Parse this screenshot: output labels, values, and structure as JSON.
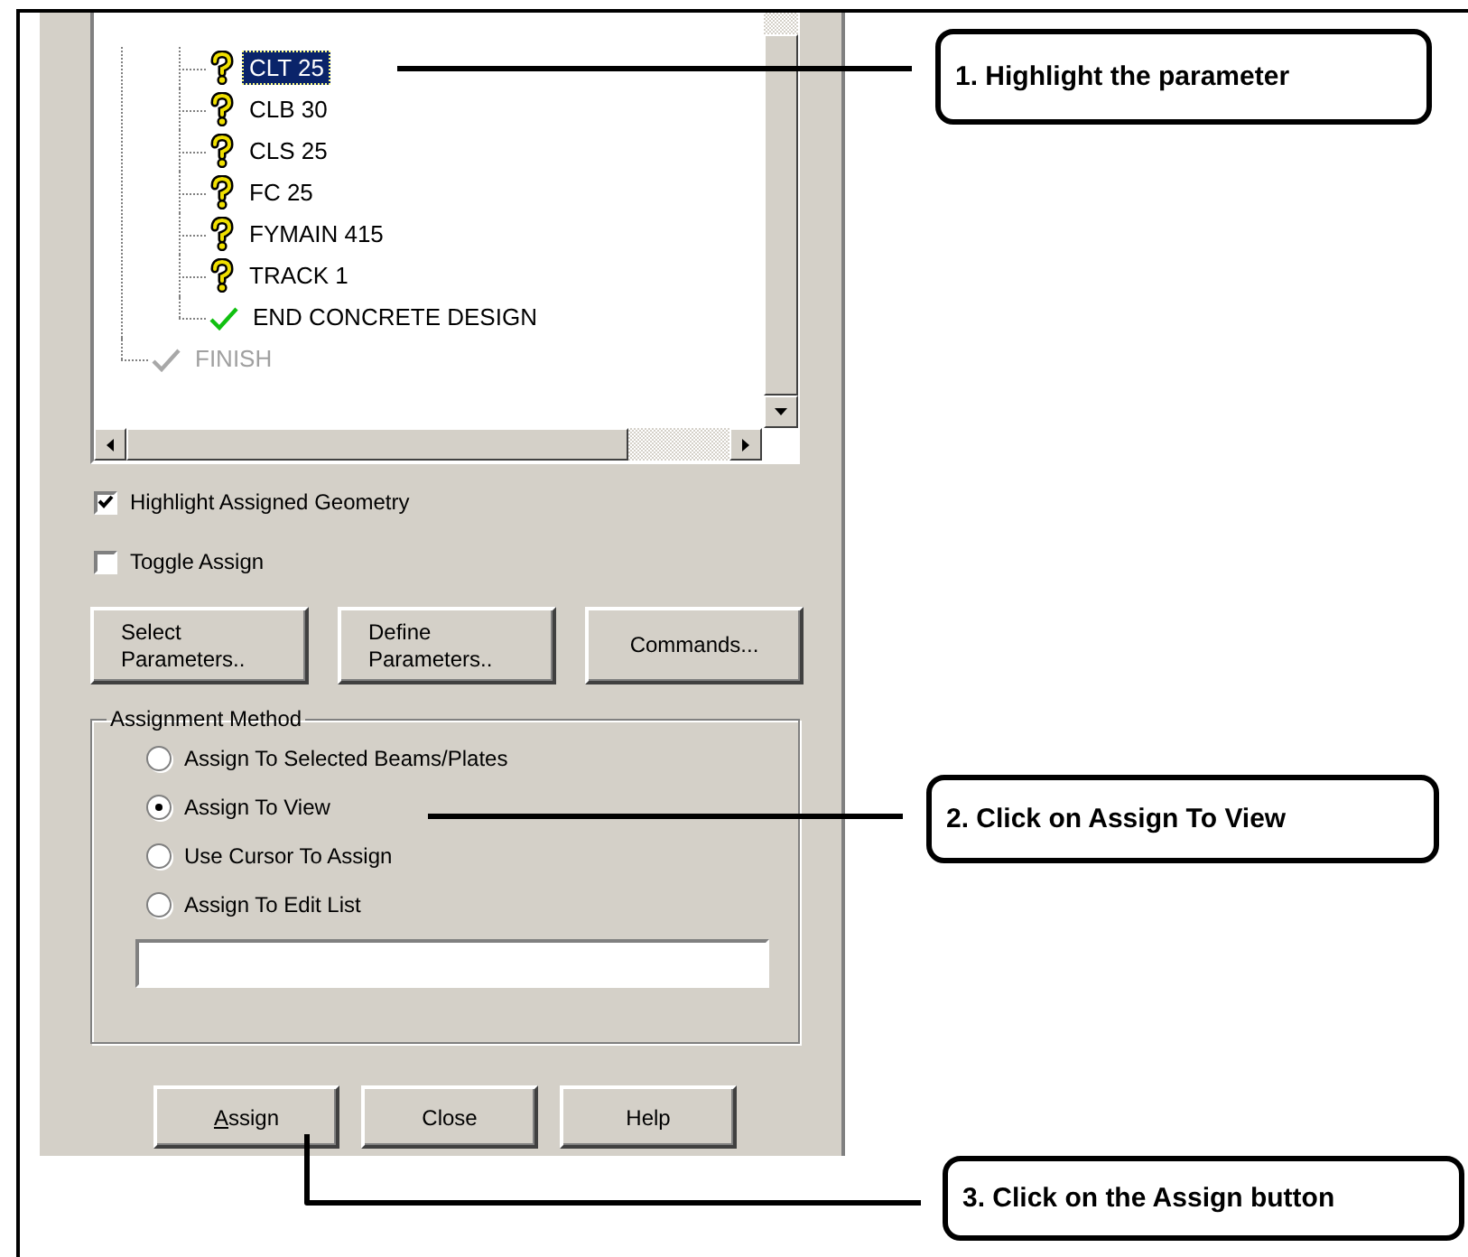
{
  "tree": {
    "items": [
      {
        "children": [
          {
            "label": "CLT 25",
            "kind": "pending",
            "selected": true
          },
          {
            "label": "CLB 30",
            "kind": "pending",
            "selected": false
          },
          {
            "label": "CLS 25",
            "kind": "pending",
            "selected": false
          },
          {
            "label": "FC 25",
            "kind": "pending",
            "selected": false
          },
          {
            "label": "FYMAIN 415",
            "kind": "pending",
            "selected": false
          },
          {
            "label": "TRACK 1",
            "kind": "pending",
            "selected": false
          },
          {
            "label": "END CONCRETE DESIGN",
            "kind": "done",
            "selected": false
          }
        ]
      },
      {
        "label": "FINISH",
        "kind": "inactive",
        "selected": false
      }
    ]
  },
  "options": [
    {
      "label": "Highlight Assigned Geometry",
      "checked": true
    },
    {
      "label": "Toggle Assign",
      "checked": false
    }
  ],
  "action_buttons": [
    {
      "lines": [
        "Select",
        "Parameters.."
      ]
    },
    {
      "lines": [
        "Define",
        "Parameters.."
      ]
    },
    {
      "lines": [
        "Commands..."
      ]
    }
  ],
  "assignment_method": {
    "title": "Assignment Method",
    "choices": [
      {
        "label": "Assign To Selected Beams/Plates",
        "selected": false
      },
      {
        "label": "Assign To View",
        "selected": true
      },
      {
        "label": "Use Cursor To Assign",
        "selected": false
      },
      {
        "label": "Assign To Edit List",
        "selected": false
      }
    ]
  },
  "dialog_buttons": [
    {
      "label": "Assign",
      "access_key": true
    },
    {
      "label": "Close"
    },
    {
      "label": "Help"
    }
  ],
  "callouts": [
    {
      "text": "1. Highlight the parameter"
    },
    {
      "text": "2. Click on Assign To View"
    },
    {
      "text": "3. Click on the Assign button"
    }
  ]
}
